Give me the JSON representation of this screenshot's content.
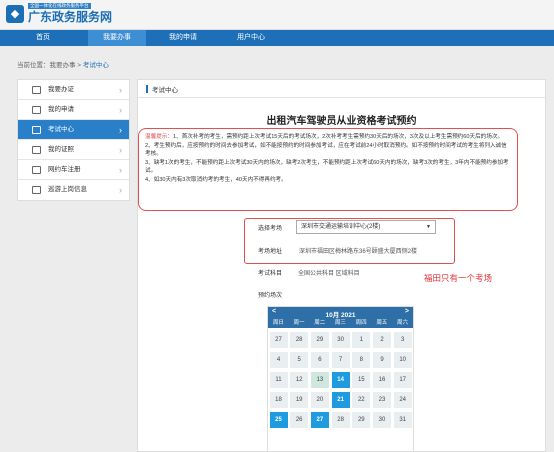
{
  "header": {
    "logo_subtitle": "全国一体化在线政务服务平台",
    "logo_title": "广东政务服务网"
  },
  "nav": {
    "items": [
      "首页",
      "我要办事",
      "我的申请",
      "用户中心"
    ]
  },
  "breadcrumb": {
    "prefix": "当前位置：我要办事 >",
    "current": "考试中心"
  },
  "sidebar": {
    "items": [
      "我要办证",
      "我的申请",
      "考试中心",
      "我的证照",
      "网约车注册",
      "巡游上岗信息"
    ],
    "active_index": 2
  },
  "panel": {
    "heading": "考试中心",
    "title": "出租汽车驾驶员从业资格考试预约"
  },
  "notice": {
    "line1_tip": "温馨提示：",
    "line1": "1、首次补考的考生，需预约距上次考试15天后的考试场次，2次补考考生需预约30天后的场次，3次及以上考生需预约60天后的场次。",
    "line2": "2、考生预约后，应按预约的时间去参加考试，如不能按预约的时间参加考试，应在考试前24小时取消预约。如不按预约时间考试的考生将列入诚信考核。",
    "line3": "3、缺考1次的考生，不能预约距上次考试30天内的场次，缺考2次考生，不能预约距上次考试60天内的场次，缺考3次的考生，3年内不能预约参加考试。",
    "line4": "4、如30天内有3次取消约考的考生，40天内不得再约考。"
  },
  "form": {
    "site_label": "选择考场",
    "site_value": "深圳市交通运输培训中心(2楼)",
    "address_label": "考场地址",
    "address_value": "深圳市福田区梅林路东36号颐盛大厦西侧2楼",
    "subject_label": "考试科目",
    "subject_value": "全国公共科目 区域科目",
    "date_label": "预约场次"
  },
  "annotation": "福田只有一个考场",
  "calendar": {
    "title": "10月 2021",
    "prev": "<",
    "next": ">",
    "weekdays": [
      "周日",
      "周一",
      "周二",
      "周三",
      "周四",
      "周五",
      "周六"
    ],
    "weeks": [
      [
        "27",
        "28",
        "29",
        "30",
        "1",
        "2",
        "3"
      ],
      [
        "4",
        "5",
        "6",
        "7",
        "8",
        "9",
        "10"
      ],
      [
        "11",
        "12",
        "13",
        "14",
        "15",
        "16",
        "17"
      ],
      [
        "18",
        "19",
        "20",
        "21",
        "22",
        "23",
        "24"
      ],
      [
        "25",
        "26",
        "27",
        "28",
        "29",
        "30",
        "31"
      ]
    ],
    "available_days": [
      "14",
      "21",
      "25",
      "27"
    ],
    "light_days": [
      "13"
    ]
  },
  "colors": {
    "primary": "#1d6fb8",
    "available": "#1f9be0",
    "annotation": "#e0333a"
  }
}
